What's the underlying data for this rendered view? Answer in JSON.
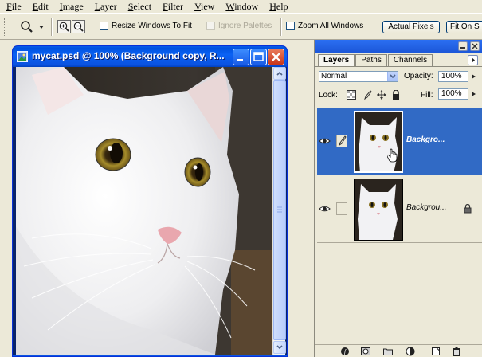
{
  "menubar": {
    "items": [
      "File",
      "Edit",
      "Image",
      "Layer",
      "Select",
      "Filter",
      "View",
      "Window",
      "Help"
    ]
  },
  "options": {
    "tool_icon": "zoom-tool-icon",
    "zoom_in_icon": "zoom-in-icon",
    "zoom_out_icon": "zoom-out-icon",
    "resize_windows": "Resize Windows To Fit",
    "ignore_palettes": "Ignore Palettes",
    "zoom_all": "Zoom All Windows",
    "actual_pixels": "Actual Pixels",
    "fit_on_screen": "Fit On S"
  },
  "document": {
    "title": "mycat.psd @ 100% (Background copy, R...",
    "controls": [
      "minimize-icon",
      "maximize-icon",
      "close-icon"
    ]
  },
  "layers_palette": {
    "tabs": [
      "Layers",
      "Paths",
      "Channels"
    ],
    "blend_mode": "Normal",
    "opacity_label": "Opacity:",
    "opacity_value": "100%",
    "lock_label": "Lock:",
    "fill_label": "Fill:",
    "fill_value": "100%",
    "layers": [
      {
        "name": "Backgro...",
        "selected": true,
        "visible": true,
        "locked": false
      },
      {
        "name": "Backgrou...",
        "selected": false,
        "visible": true,
        "locked": true
      }
    ],
    "bottom_icons": [
      "layer-style-icon",
      "mask-icon",
      "group-folder-icon",
      "adjustment-layer-icon",
      "new-layer-icon",
      "trash-icon"
    ]
  },
  "colors": {
    "titlebar_blue": "#0a5ee8",
    "selection_blue": "#316ac5",
    "chrome": "#ece9d8"
  }
}
